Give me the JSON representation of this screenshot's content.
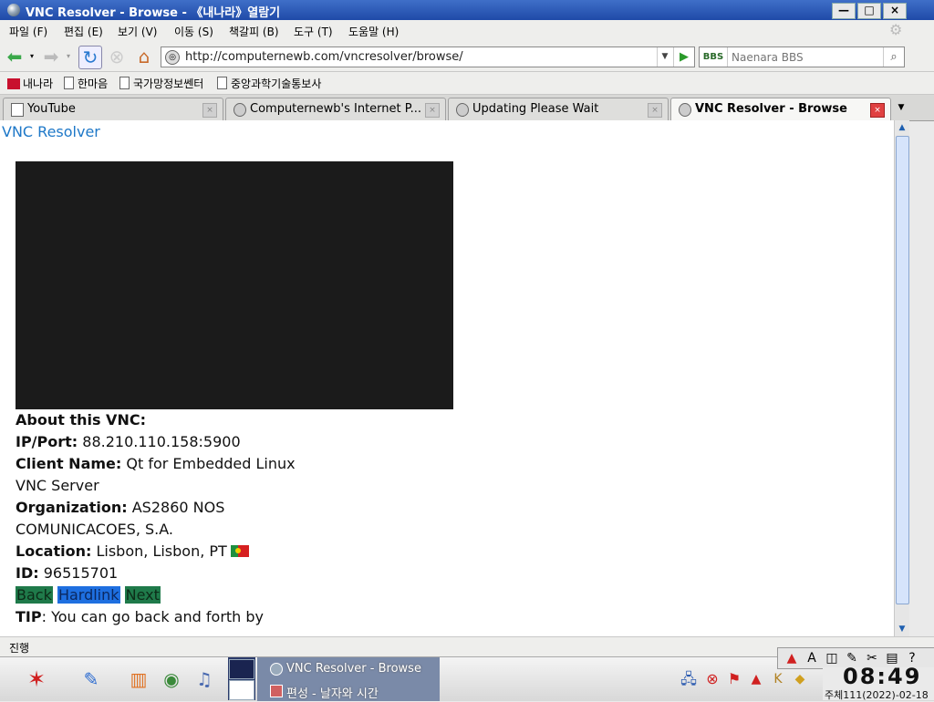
{
  "window": {
    "title": "VNC Resolver - Browse - 《내나라》열람기",
    "buttons": {
      "minimize": "—",
      "maximize": "□",
      "close": "×"
    }
  },
  "menu": [
    "파일 (F)",
    "편집 (E)",
    "보기 (V)",
    "이동 (S)",
    "책갈피 (B)",
    "도구 (T)",
    "도움말 (H)"
  ],
  "navbar": {
    "url": "http://computernewb.com/vncresolver/browse/",
    "search_engine": "BBS",
    "search_placeholder": "Naenara BBS"
  },
  "bookmarks": [
    "내나라",
    "한마음",
    "국가망정보쎈터",
    "중앙과학기술통보사"
  ],
  "tabs": [
    {
      "label": "YouTube",
      "active": false
    },
    {
      "label": "Computernewb's Internet P...",
      "active": false
    },
    {
      "label": "Updating Please Wait",
      "active": false
    },
    {
      "label": "VNC Resolver - Browse",
      "active": true
    }
  ],
  "page": {
    "site_title": "VNC Resolver",
    "about_heading": "About this VNC:",
    "ip_label": "IP/Port:",
    "ip_value": "88.210.110.158:5900",
    "client_label": "Client Name:",
    "client_value_line1": "Qt for Embedded Linux",
    "client_value_line2": "VNC Server",
    "org_label": "Organization:",
    "org_value_line1": "AS2860 NOS",
    "org_value_line2": "COMUNICACOES, S.A.",
    "location_label": "Location:",
    "location_value": "Lisbon, Lisbon, PT",
    "id_label": "ID:",
    "id_value": "96515701",
    "back_label": "Back",
    "hardlink_label": "Hardlink",
    "next_label": "Next",
    "tip_label": "TIP",
    "tip_text": ": You can go back and forth by"
  },
  "statusbar": {
    "text": "진행"
  },
  "taskbar": {
    "tasks": [
      "VNC Resolver - Browse",
      "편성 - 날자와 시간"
    ],
    "clock_time": "08:49",
    "clock_date": "주체111(2022)-02-18"
  }
}
